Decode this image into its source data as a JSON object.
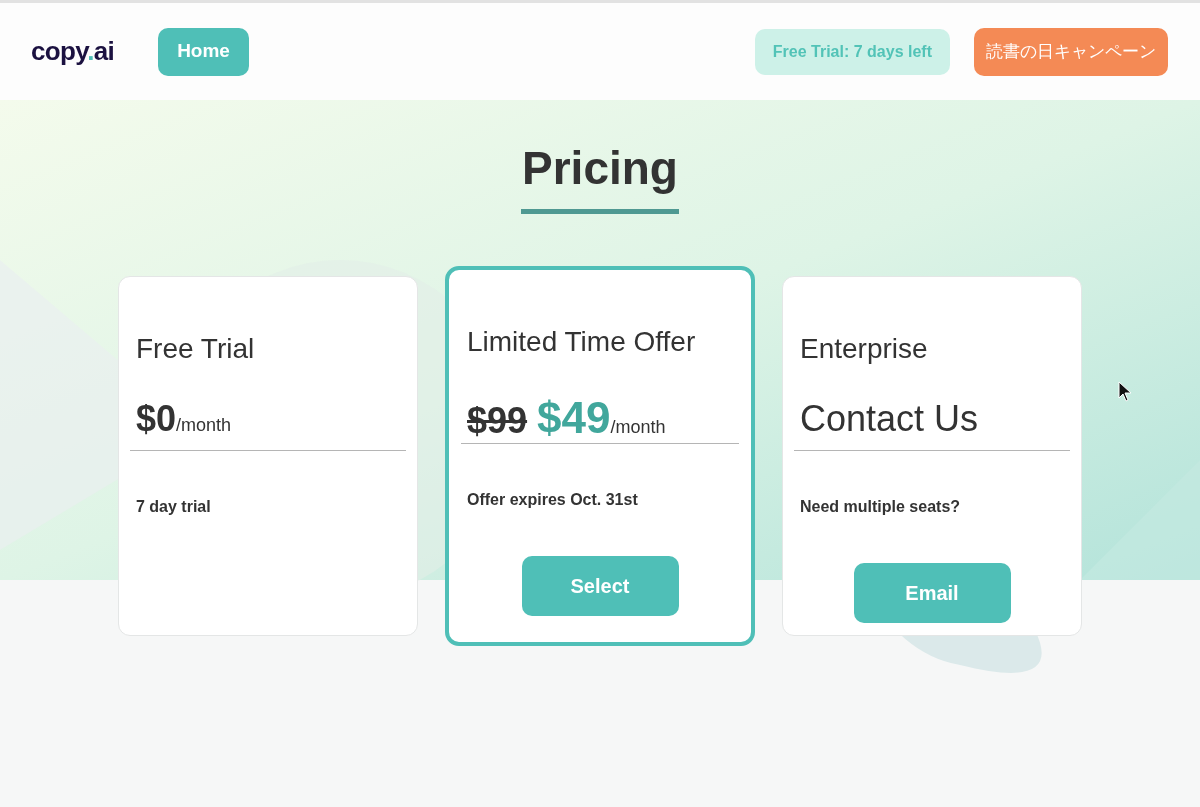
{
  "header": {
    "logo": [
      {
        "text": "copy",
        "accent": false
      },
      {
        "text": ".",
        "accent": true
      },
      {
        "text": "ai",
        "accent": false
      }
    ],
    "home_button": "Home",
    "trial_badge": "Free Trial: 7 days left",
    "campaign_button": "読書の日キャンペーン"
  },
  "title": "Pricing",
  "plans": [
    {
      "name": "Free Trial",
      "featured": false,
      "price": "$0",
      "period": "/month",
      "note": "7 day trial"
    },
    {
      "name": "Limited Time Offer",
      "featured": true,
      "old_price": "$99",
      "price": "$49",
      "period": "/month",
      "note": "Offer expires Oct. 31st",
      "button": "Select"
    },
    {
      "name": "Enterprise",
      "featured": false,
      "price": "Contact Us",
      "note": "Need multiple seats?",
      "button": "Email"
    }
  ]
}
